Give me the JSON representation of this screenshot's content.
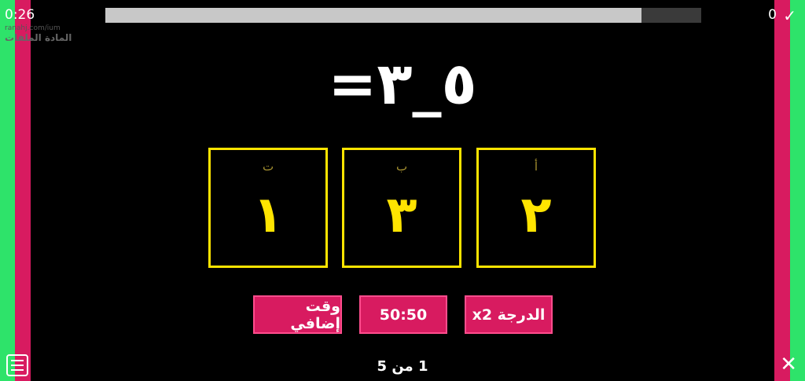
{
  "header": {
    "timer": "0:26",
    "score": "0",
    "watermark_line1": "ranahj.com/ium",
    "watermark_line2": "المادة الملفات",
    "progress": 0.9
  },
  "question": {
    "text": "٥_٣="
  },
  "options": [
    {
      "letter": "أ",
      "value": "٢"
    },
    {
      "letter": "ب",
      "value": "٣"
    },
    {
      "letter": "ت",
      "value": "١"
    }
  ],
  "lifelines": {
    "double_score": "الدرجة x2",
    "fifty_fifty": "50:50",
    "extra_time": "وقت إضافي"
  },
  "footer": {
    "counter": "1 من 5"
  },
  "icons": {
    "check": "check-icon",
    "menu": "menu-icon",
    "close": "close-icon"
  },
  "colors": {
    "accent": "#ffe400",
    "button": "#d81b60",
    "edge_green": "#2ee36a"
  }
}
